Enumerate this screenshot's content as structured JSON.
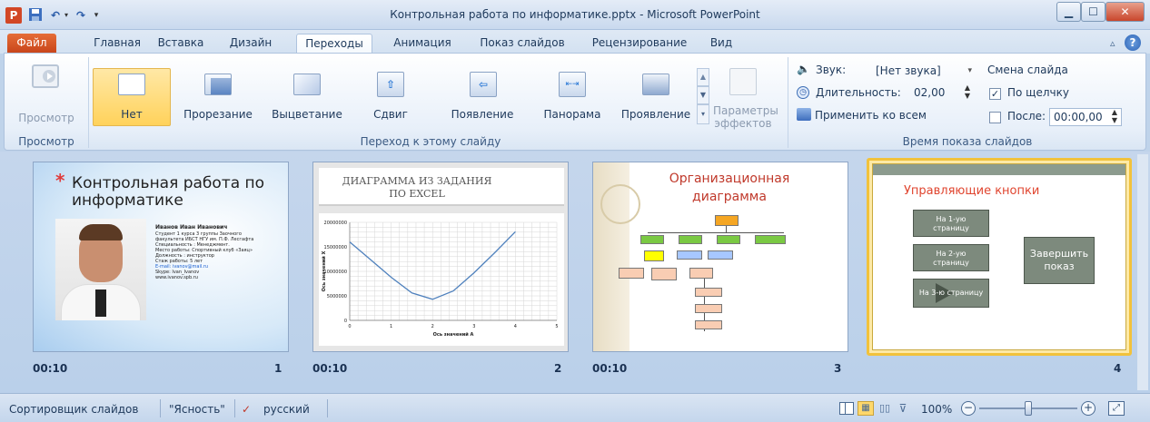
{
  "window": {
    "title": "Контрольная работа по информатике.pptx - Microsoft PowerPoint",
    "app_icon_letter": "P"
  },
  "tabs": {
    "file": "Файл",
    "items": [
      "Главная",
      "Вставка",
      "Дизайн",
      "Переходы",
      "Анимация",
      "Показ слайдов",
      "Рецензирование",
      "Вид"
    ],
    "active": "Переходы"
  },
  "ribbon": {
    "preview": {
      "button": "Просмотр",
      "group": "Просмотр"
    },
    "transitions": {
      "group": "Переход к этому слайду",
      "items": [
        "Нет",
        "Прорезание",
        "Выцветание",
        "Сдвиг",
        "Появление",
        "Панорама",
        "Проявление"
      ],
      "selected": "Нет",
      "effects_line1": "Параметры",
      "effects_line2": "эффектов"
    },
    "timing": {
      "group": "Время показа слайдов",
      "sound_label": "Звук:",
      "sound_value": "[Нет звука]",
      "duration_label": "Длительность:",
      "duration_value": "02,00",
      "apply_all": "Применить ко всем",
      "advance_title": "Смена слайда",
      "on_click_label": "По щелчку",
      "on_click_checked": true,
      "after_label": "После:",
      "after_checked": false,
      "after_value": "00:00,00"
    }
  },
  "slides": [
    {
      "time": "00:10",
      "number": "1",
      "star": "*",
      "title": "Контрольная работа по информатике",
      "lines": [
        "Иванов Иван Иванович",
        "Студент 1 курса 3 группы Заочного",
        "факультета ИБСТ НГУ им. П.Ф. Лесгафта",
        "Специальность : Менеджмент.",
        "Место работы: Спортивный клуб «Заяц»",
        "Должность : инструктор",
        "Стаж работы: 5 лет",
        "E-mail: ivanov@mail.ru",
        "Skype: Ivan_Ivanov",
        "www.ivanov.spb.ru"
      ]
    },
    {
      "time": "00:10",
      "number": "2",
      "title_line1": "ДИАГРАММА ИЗ ЗАДАНИЯ",
      "title_line2": "ПО EXCEL",
      "chart_data": {
        "type": "line",
        "x": [
          0,
          0.5,
          1,
          1.5,
          2,
          2.5,
          3,
          3.5,
          4
        ],
        "y": [
          16000000,
          12400000,
          8800000,
          5600000,
          4300000,
          6000000,
          9700000,
          13800000,
          18100000
        ],
        "xlim": [
          0,
          5
        ],
        "ylim": [
          0,
          20000000
        ],
        "xticks": [
          "0",
          "1",
          "2",
          "3",
          "4",
          "5"
        ],
        "yticks": [
          "0",
          "5000000",
          "10000000",
          "15000000",
          "20000000"
        ],
        "xlabel": "Ось значений А",
        "ylabel": "Ось значений Х",
        "color": "#4f81bd",
        "grid": true
      }
    },
    {
      "time": "00:10",
      "number": "3",
      "title_line1": "Организационная",
      "title_line2": "диаграмма"
    },
    {
      "time": "",
      "number": "4",
      "title": "Управляющие кнопки",
      "buttons": [
        {
          "line1": "На 1-ую",
          "line2": "страницу"
        },
        {
          "line1": "На 2-ую",
          "line2": "страницу"
        },
        {
          "line1": "На 3-ю страницу",
          "line2": ""
        }
      ],
      "finish_line1": "Завершить",
      "finish_line2": "показ"
    }
  ],
  "statusbar": {
    "view": "Сортировщик слайдов",
    "theme": "\"Ясность\"",
    "language": "русский",
    "zoom": "100%",
    "zoom_level_pct": 50
  },
  "colors": {
    "accent_selected": "#ffd25b",
    "file_tab": "#d3541f",
    "slide4_border": "#f2c23b",
    "slide4_title": "#e0452f"
  }
}
